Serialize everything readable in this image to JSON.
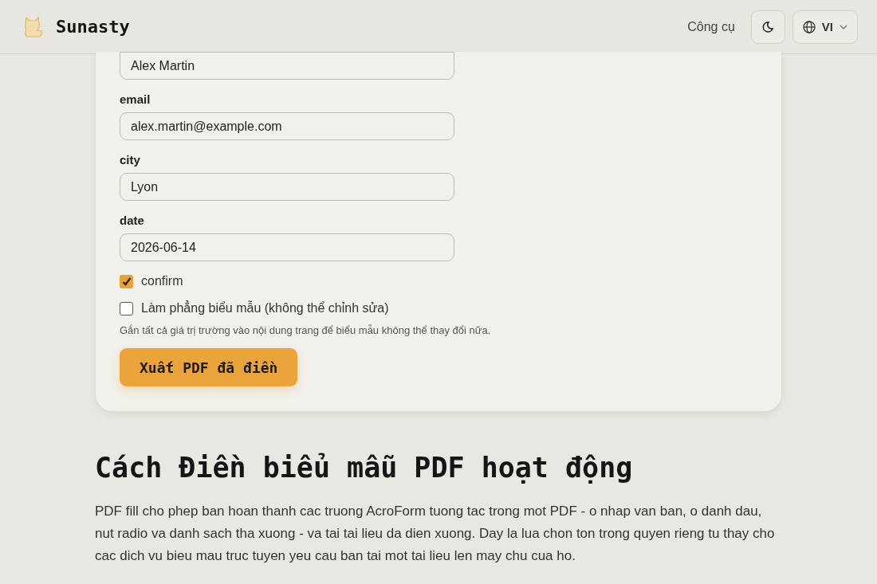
{
  "header": {
    "brand": "Sunasty",
    "nav_link": "Công cụ",
    "language": "VI"
  },
  "form": {
    "fields": [
      {
        "value": "Alex Martin"
      },
      {
        "label": "email",
        "value": "alex.martin@example.com"
      },
      {
        "label": "city",
        "value": "Lyon"
      },
      {
        "label": "date",
        "value": "2026-06-14"
      }
    ],
    "checkboxes": [
      {
        "label": "confirm",
        "checked": true
      },
      {
        "label": "Làm phẳng biểu mẫu (không thể chỉnh sửa)",
        "checked": false
      }
    ],
    "hint": "Gắn tất cả giá trị trường vào nội dung trang để biểu mẫu không thể thay đổi nữa.",
    "submit": "Xuất PDF đã điền"
  },
  "article": {
    "heading": "Cách Điền biểu mẫu PDF hoạt động",
    "paragraph": "PDF fill cho phep ban hoan thanh cac truong AcroForm tuong tac trong mot PDF - o nhap van ban, o danh dau, nut radio va danh sach tha xuong - va tai tai lieu da dien xuong. Day la lua chon ton trong quyen rieng tu thay cho cac dich vu bieu mau truc tuyen yeu cau ban tai mot tai lieu len may chu cua ho."
  }
}
